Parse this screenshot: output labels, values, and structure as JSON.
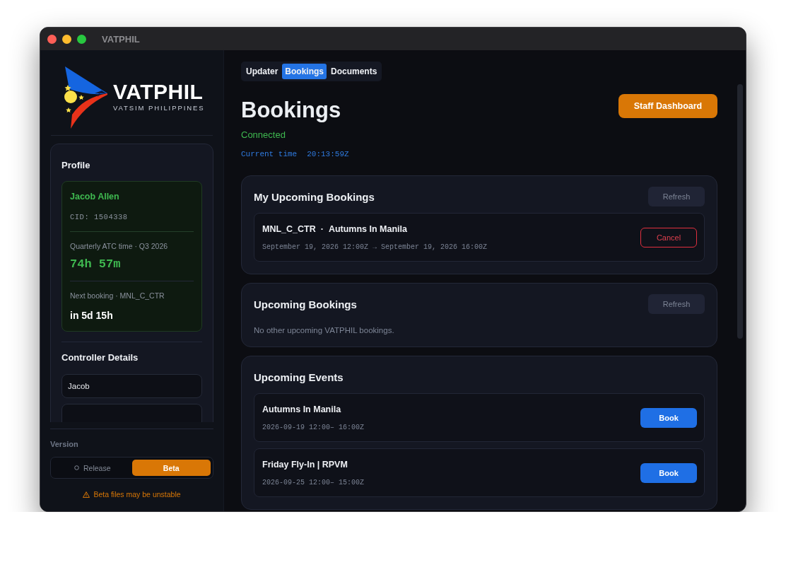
{
  "window": {
    "title": "VATPHIL"
  },
  "logo": {
    "name": "VATPHIL",
    "subtitle": "VATSIM PHILIPPINES"
  },
  "profile": {
    "heading": "Profile",
    "name": "Jacob Allen",
    "cid": "CID: 1504338",
    "atc_label": "Quarterly ATC time · Q3 2026",
    "atc_time": "74h 57m",
    "next_label": "Next booking · MNL_C_CTR",
    "next_value": "in 5d 15h"
  },
  "controller_details": {
    "heading": "Controller Details",
    "fields": [
      {
        "value": "Jacob"
      }
    ]
  },
  "version": {
    "label": "Version",
    "options": [
      {
        "label": "Release",
        "selected": false
      },
      {
        "label": "Beta",
        "selected": true
      }
    ],
    "warning": "Beta files may be unstable"
  },
  "tabs": [
    {
      "label": "Updater",
      "selected": false
    },
    {
      "label": "Bookings",
      "selected": true
    },
    {
      "label": "Documents",
      "selected": false
    }
  ],
  "page": {
    "title": "Bookings",
    "status": "Connected",
    "time_label": "Current time",
    "time_value": "20:13:59Z",
    "staff_button": "Staff Dashboard"
  },
  "my_bookings": {
    "heading": "My Upcoming Bookings",
    "refresh_button": "Refresh",
    "items": [
      {
        "position": "MNL_C_CTR",
        "separator": "·",
        "event": "Autumns In Manila",
        "time": "September 19, 2026 12:00Z → September 19, 2026 16:00Z",
        "action": "Cancel"
      }
    ]
  },
  "upcoming_bookings": {
    "heading": "Upcoming Bookings",
    "refresh_button": "Refresh",
    "empty_message": "No other upcoming VATPHIL bookings."
  },
  "events": {
    "heading": "Upcoming Events",
    "items": [
      {
        "name": "Autumns In Manila",
        "time": "2026-09-19 12:00– 16:00Z",
        "action": "Book"
      },
      {
        "name": "Friday Fly-In | RPVM",
        "time": "2026-09-25 12:00– 15:00Z",
        "action": "Book"
      }
    ]
  }
}
